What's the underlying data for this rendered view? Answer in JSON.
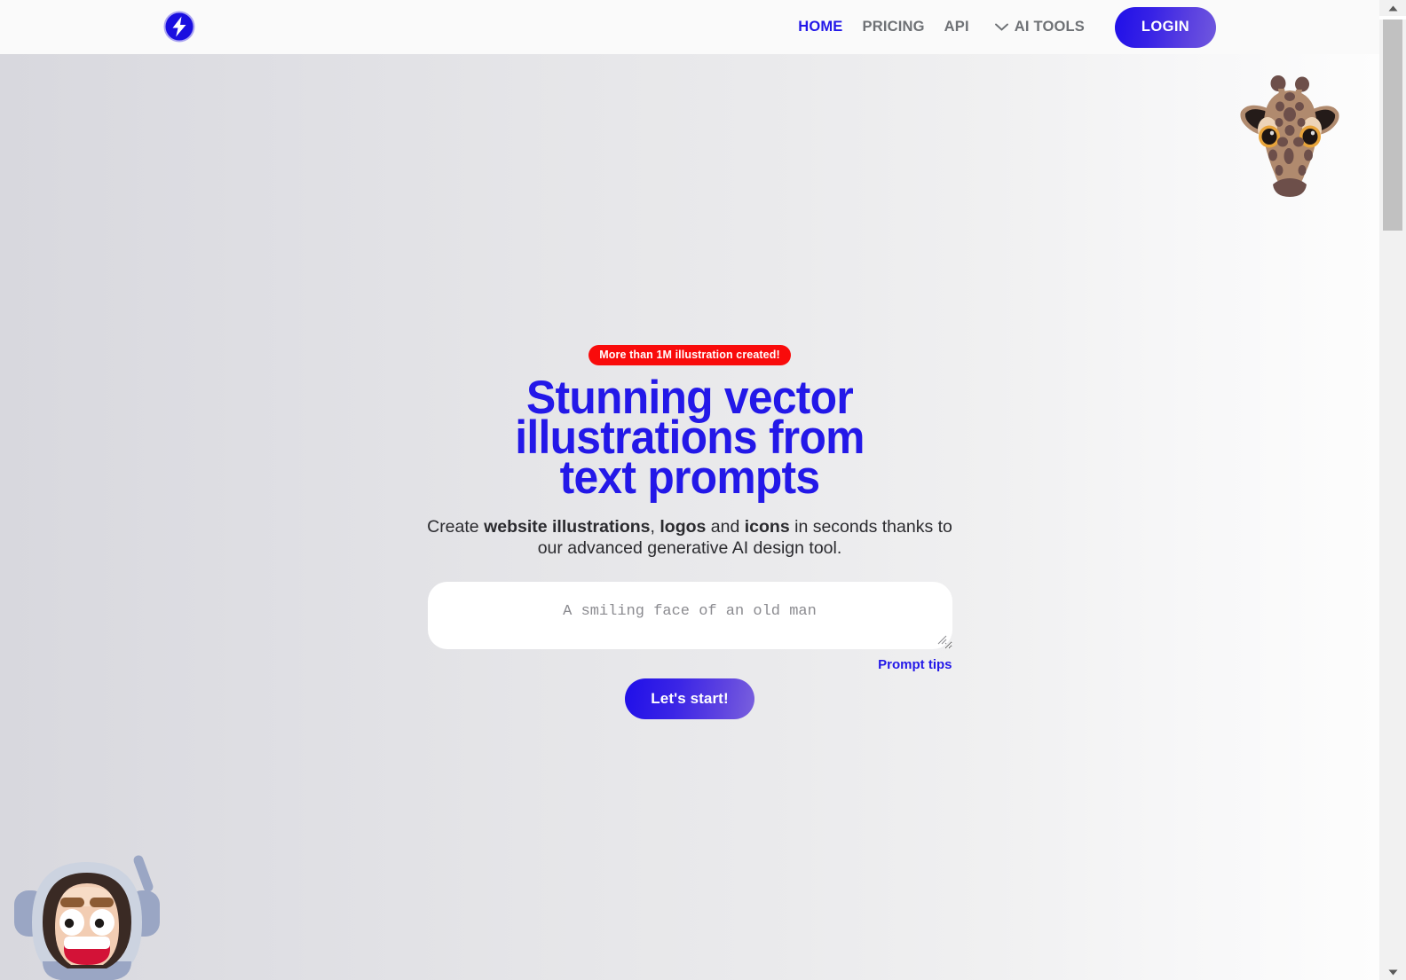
{
  "header": {
    "logo_icon": "lightning-bolt-logo",
    "nav": [
      {
        "label": "HOME",
        "active": true
      },
      {
        "label": "PRICING",
        "active": false
      },
      {
        "label": "API",
        "active": false
      }
    ],
    "dropdown": {
      "label": "AI TOOLS",
      "icon": "chevron-down-icon"
    },
    "login_label": "LOGIN"
  },
  "hero": {
    "badge": "More than 1M illustration created!",
    "headline": "Stunning vector illustrations from text prompts",
    "subtitle": {
      "part1": "Create ",
      "bold1": "website illustrations",
      "part2": ", ",
      "bold2": "logos",
      "part3": " and ",
      "bold3": "icons",
      "part4": " in seconds thanks to our advanced generative AI design tool."
    },
    "prompt_placeholder": "A smiling face of an old man",
    "prompt_value": "",
    "prompt_tips_label": "Prompt tips",
    "start_label": "Let's start!"
  },
  "decorations": {
    "giraffe_alt": "giraffe-head-illustration",
    "astronaut_alt": "astronaut-face-illustration"
  },
  "colors": {
    "brand_blue": "#2318e8",
    "badge_red": "#f90b0b",
    "nav_gray": "#6e7175"
  },
  "scrollbar": {
    "up_icon": "scroll-up-arrow",
    "down_icon": "scroll-down-arrow"
  }
}
